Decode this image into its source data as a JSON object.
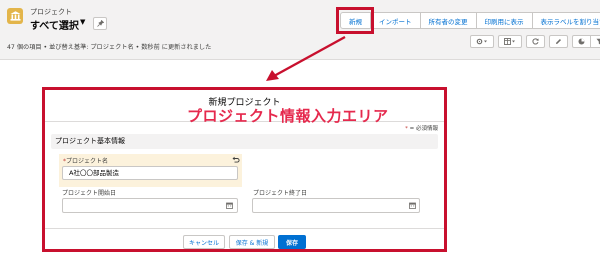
{
  "header": {
    "breadcrumb": "プロジェクト",
    "list_view_title": "すべて選択",
    "meta_text": "47 個の項目 • 並び替え基準: プロジェクト名 • 数秒前 に更新されました"
  },
  "actions": {
    "new": "新規",
    "import": "インポート",
    "change_owner": "所有者の変更",
    "print": "印刷用に表示",
    "assign_label": "表示ラベルを割り当て"
  },
  "toolbar_icons": [
    "gear-icon",
    "table-icon",
    "refresh-icon",
    "edit-icon",
    "chart-icon",
    "filter-icon"
  ],
  "modal": {
    "title": "新規プロジェクト",
    "annotation": "プロジェクト情報入力エリア",
    "required_note": "= 必須情報",
    "required_mark": "*",
    "section_title": "プロジェクト基本情報",
    "fields": {
      "name": {
        "label": "プロジェクト名",
        "value": "A社〇〇部品製造"
      },
      "start_date": {
        "label": "プロジェクト開始日",
        "value": ""
      },
      "end_date": {
        "label": "プロジェクト終了日",
        "value": ""
      }
    },
    "buttons": {
      "cancel": "キャンセル",
      "save_new": "保存 & 新規",
      "save": "保存"
    }
  },
  "colors": {
    "highlight": "#c8102e",
    "annotation": "#e5294d",
    "brand": "#0070d2",
    "app_icon": "#e3b54a"
  }
}
